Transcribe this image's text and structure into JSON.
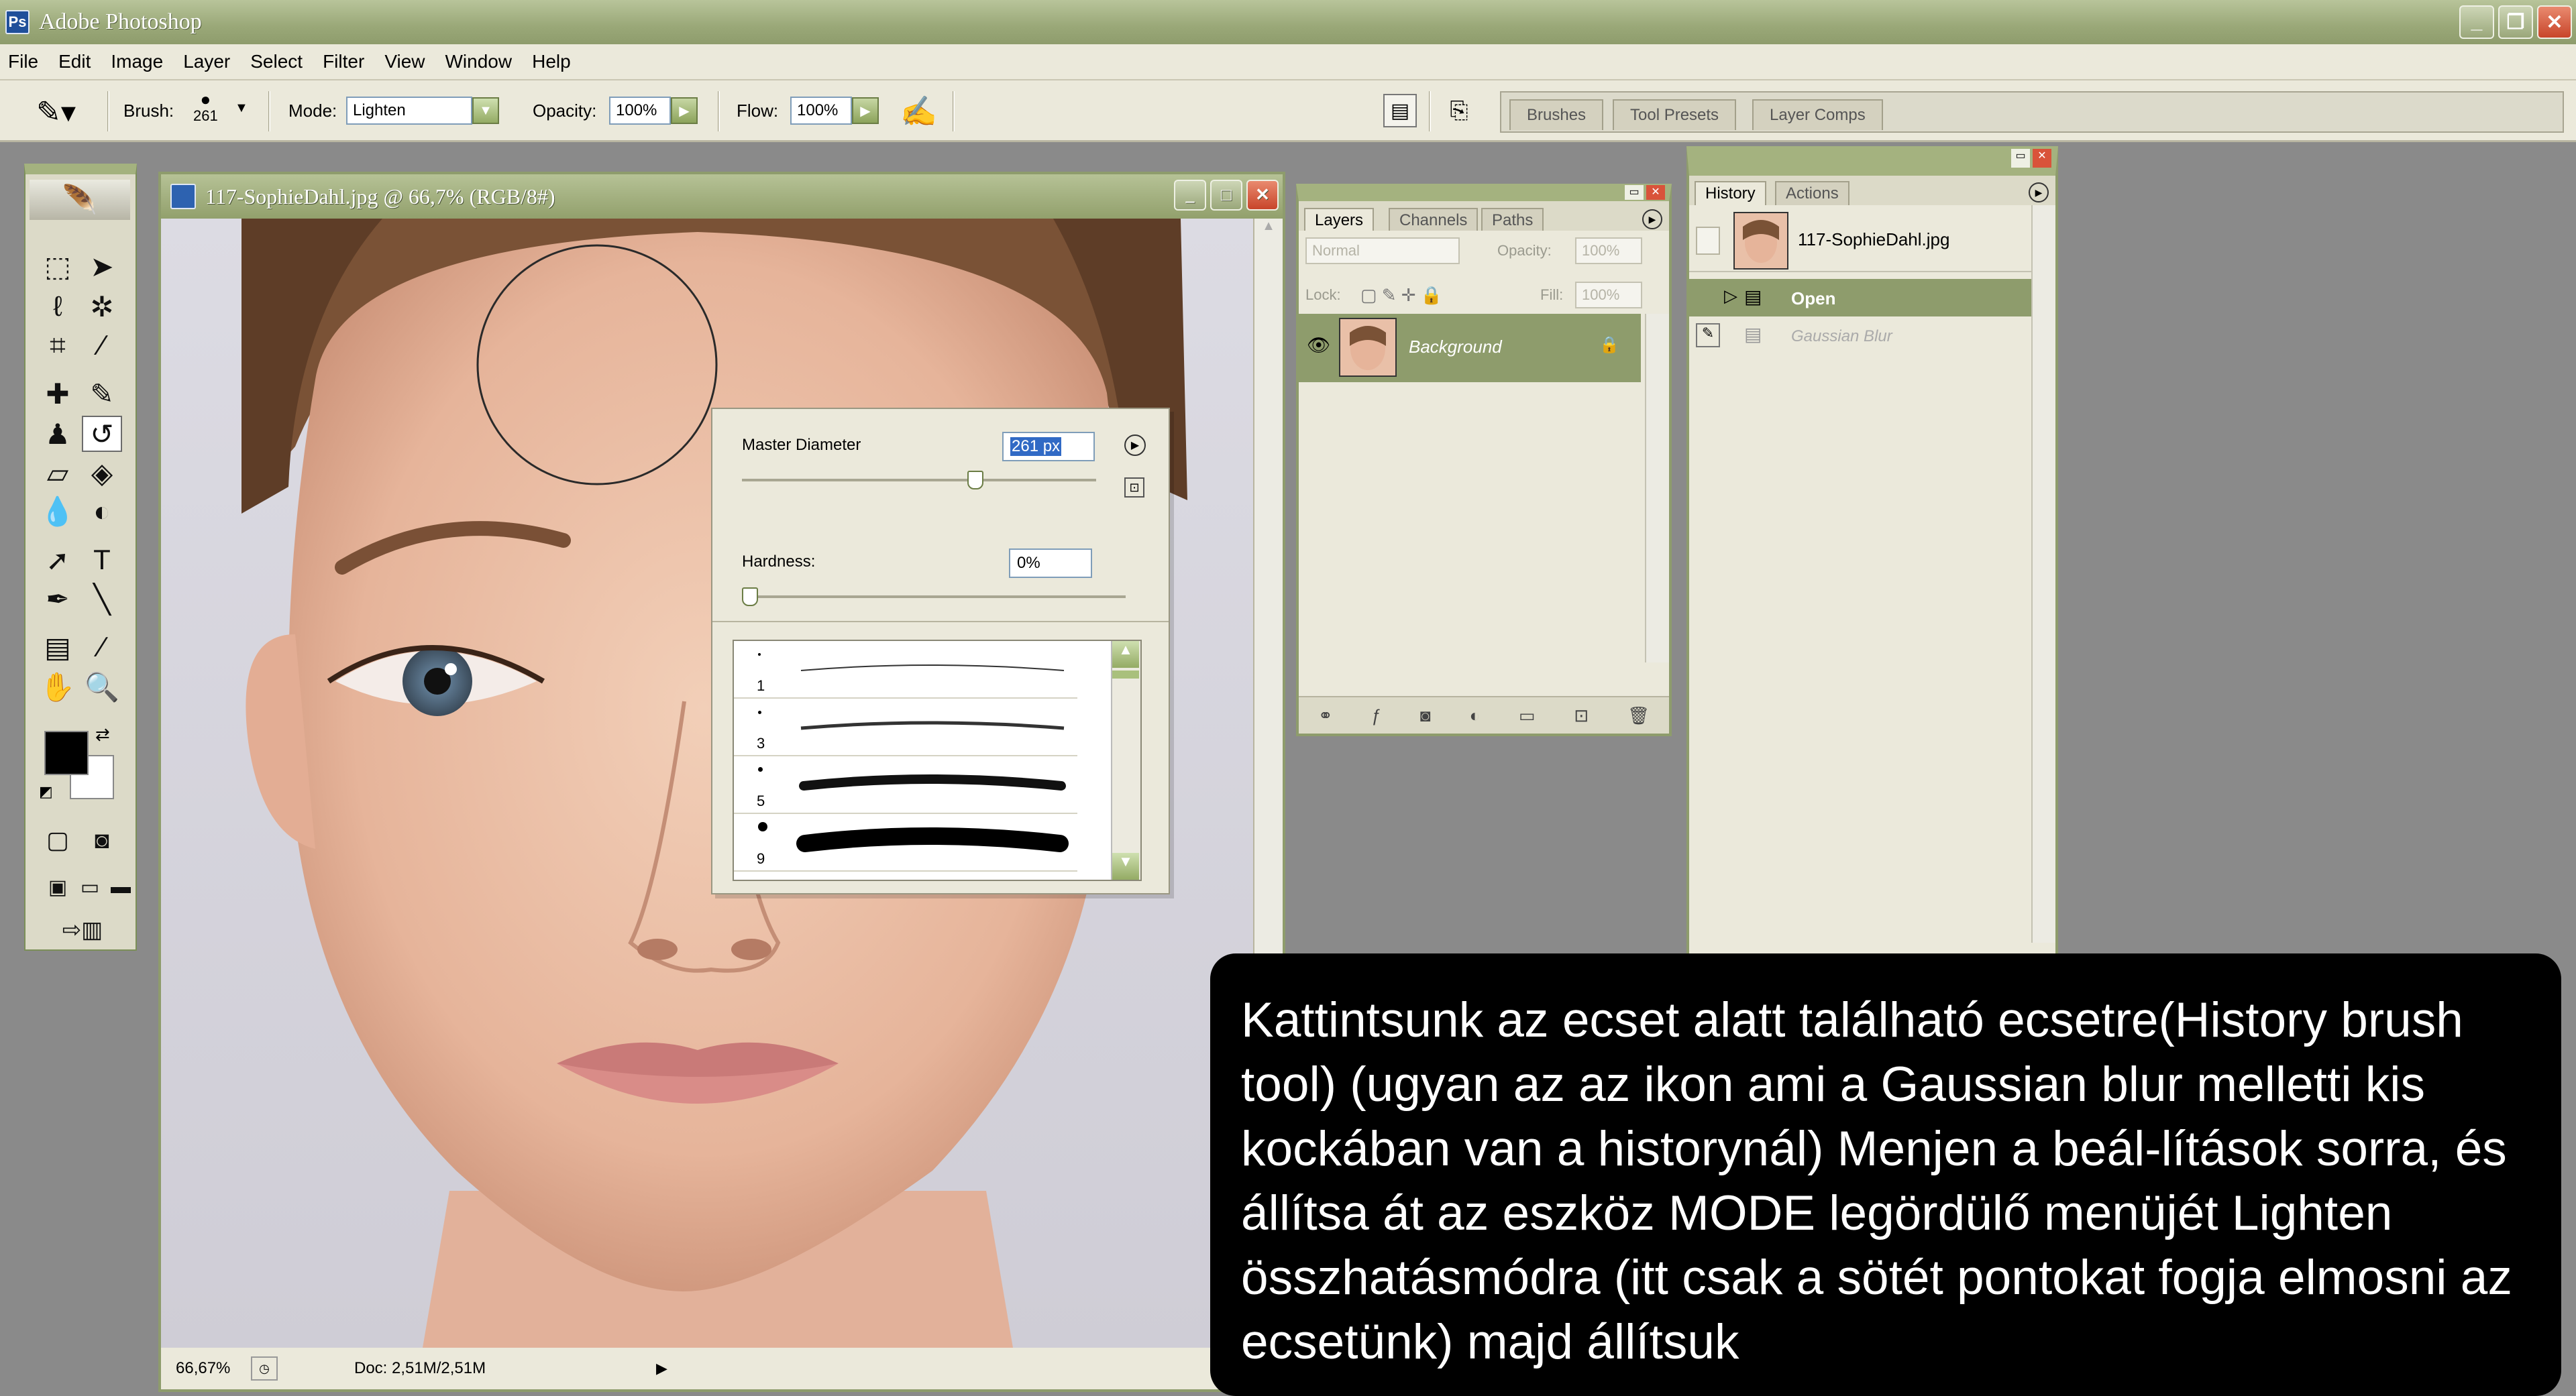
{
  "app": {
    "title": "Adobe Photoshop",
    "window_buttons": [
      "_",
      "❐",
      "✕"
    ]
  },
  "menu": [
    "File",
    "Edit",
    "Image",
    "Layer",
    "Select",
    "Filter",
    "View",
    "Window",
    "Help"
  ],
  "options_bar": {
    "brush_label": "Brush:",
    "brush_size": "261",
    "mode_label": "Mode:",
    "mode_value": "Lighten",
    "opacity_label": "Opacity:",
    "opacity_value": "100%",
    "flow_label": "Flow:",
    "flow_value": "100%",
    "palette_well_tabs": [
      "Brushes",
      "Tool Presets",
      "Layer Comps"
    ]
  },
  "document": {
    "title": "117-SophieDahl.jpg @ 66,7% (RGB/8#)",
    "zoom": "66,67%",
    "doc_size": "Doc: 2,51M/2,51M"
  },
  "brush_popup": {
    "master_diameter_label": "Master Diameter",
    "master_diameter_value": "261 px",
    "master_diameter_level": 0.66,
    "hardness_label": "Hardness:",
    "hardness_value": "0%",
    "hardness_level": 0.0,
    "brushes": [
      {
        "size": "1"
      },
      {
        "size": "3"
      },
      {
        "size": "5"
      },
      {
        "size": "9"
      }
    ]
  },
  "layers_panel": {
    "tabs": [
      "Layers",
      "Channels",
      "Paths"
    ],
    "blend_mode": "Normal",
    "opacity_label": "Opacity:",
    "opacity_value": "100%",
    "lock_label": "Lock:",
    "fill_label": "Fill:",
    "fill_value": "100%",
    "layer_name": "Background"
  },
  "history_panel": {
    "tabs": [
      "History",
      "Actions"
    ],
    "snapshot_name": "117-SophieDahl.jpg",
    "states": [
      "Open",
      "Gaussian Blur"
    ]
  },
  "caption": {
    "text": "Kattintsunk az ecset alatt található ecsetre(History brush tool) (ugyan az az ikon ami a Gaussian blur melletti kis kockában van a historynál) Menjen a beál-lítások sorra, és állítsa át az eszköz MODE legördülő menüjét  Lighten összhatásmódra (itt csak a sötét pontokat fogja elmosni az ecsetünk)  majd állítsuk"
  },
  "colors": {
    "titlebar": "#9aa878",
    "panel_bg": "#ebe9db",
    "history_selected": "#8e9c6c",
    "caption_bg": "#000000"
  }
}
